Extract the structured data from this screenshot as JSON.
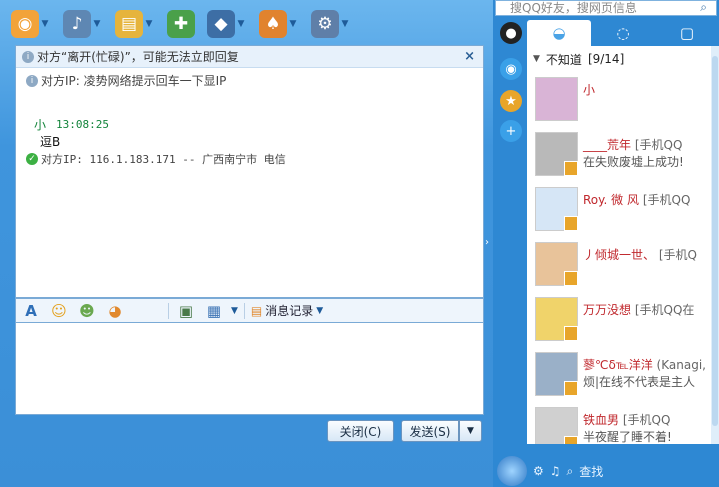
{
  "chat": {
    "toolbar": [
      {
        "icon": "webcam-icon",
        "glyph": "◉",
        "color": "#f2a33a"
      },
      {
        "icon": "microphone-icon",
        "glyph": "🎤",
        "color": "#5e87b3"
      },
      {
        "icon": "folder-icon",
        "glyph": "📂",
        "color": "#e6b43c"
      },
      {
        "icon": "doc-add-icon",
        "glyph": "📝",
        "color": "#4aa04a"
      },
      {
        "icon": "teacher-icon",
        "glyph": "🎓",
        "color": "#3d6ea5"
      },
      {
        "icon": "apps-icon",
        "glyph": "♠",
        "color": "#e1832e"
      },
      {
        "icon": "settings-icon",
        "glyph": "⚙",
        "color": "#5f7fa8"
      }
    ],
    "notice": "对方“离开(忙碌)”，可能无法立即回复",
    "ip_hint": "对方IP: 凌势网络提示回车一下显IP",
    "message": {
      "sender": "小",
      "time": "13:08:25",
      "text": "逗B"
    },
    "ip_result": "对方IP: 116.1.183.171 -- 广西南宁市 电信",
    "input_tools": [
      "A",
      "☺",
      "☻",
      "◕"
    ],
    "history_label": "消息记录",
    "close_label": "关闭(C)",
    "send_label": "发送(S)"
  },
  "qq": {
    "search_placeholder": "搜QQ好友，搜网页信息",
    "group": {
      "name": "不知道",
      "count": "[9/14]"
    },
    "friends": [
      {
        "name": "小",
        "src": "",
        "sig": "",
        "avatar": "#d9b4d6"
      },
      {
        "name": "____荒年",
        "src": "[手机QQ",
        "sig": "在失败废墟上成功!",
        "avatar": "#b9b9b9"
      },
      {
        "name": "Roy. 微 风",
        "src": "[手机QQ",
        "sig": "",
        "avatar": "#d6e6f6"
      },
      {
        "name": "丿倾城一世、",
        "src": "[手机Q",
        "sig": "",
        "avatar": "#e8c39a"
      },
      {
        "name": "万万没想",
        "src": "[手机QQ在",
        "sig": "",
        "avatar": "#f0d36a"
      },
      {
        "name": "蓼℃δ℡洋洋",
        "src": "(Kanagi,",
        "sig": "烦|在线不代表是主人",
        "avatar": "#9ab0c8"
      },
      {
        "name": "铁血男",
        "src": "[手机QQ",
        "sig": "半夜醒了睡不着!",
        "avatar": "#d0d0d0"
      }
    ],
    "find_label": "查找"
  }
}
